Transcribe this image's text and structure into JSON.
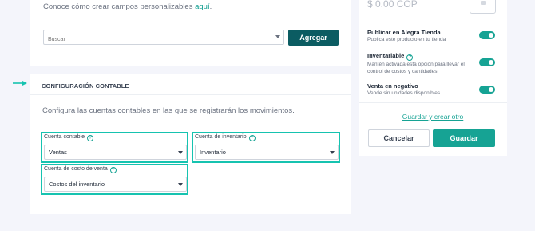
{
  "top_card": {
    "hint_text": "Conoce cómo crear campos personalizables ",
    "hint_link": "aquí",
    "hint_suffix": ".",
    "search_placeholder": "Buscar",
    "add_button": "Agregar"
  },
  "config": {
    "title": "CONFIGURACIÓN CONTABLE",
    "description": "Configura las cuentas contables en las que se registrarán los movimientos.",
    "fields": [
      {
        "label": "Cuenta contable",
        "value": "Ventas"
      },
      {
        "label": "Cuenta de inventario",
        "value": "Inventario"
      },
      {
        "label": "Cuenta de costo de venta",
        "value": "Costos del inventario"
      }
    ]
  },
  "side": {
    "price": "$ 0.00 COP",
    "settings": [
      {
        "title": "Publicar en Alegra Tienda",
        "desc": "Publica este producto en tu tienda",
        "enabled": true
      },
      {
        "title": "Inventariable",
        "desc_line1": "Mantén activada esta opción para llevar el",
        "desc_line2": "control de costos y cantidades",
        "enabled": true
      },
      {
        "title": "Venta en negativo",
        "desc": "Vende sin unidades disponibles",
        "enabled": true
      }
    ],
    "save_and_new": "Guardar y crear otro",
    "cancel_button": "Cancelar",
    "save_button": "Guardar"
  },
  "colors": {
    "accent": "#16a394",
    "highlight": "#16c3b0",
    "primary_dark": "#0b5c62"
  },
  "icons": {
    "help": "question-circle-icon",
    "caret": "chevron-down-icon",
    "arrow": "arrow-right-icon",
    "image": "image-placeholder-icon"
  }
}
